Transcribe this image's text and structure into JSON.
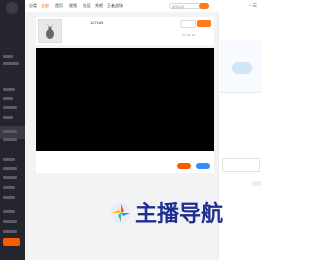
{
  "header": {
    "nav": [
      "分类",
      "全部",
      "首页",
      "视频",
      "社区",
      "秀吧",
      "王者战场"
    ],
    "active_nav_index": 1,
    "search": {
      "placeholder": "搜索房间"
    }
  },
  "room": {
    "anchor_name": "",
    "room_id": "127165",
    "sub_info": "",
    "follow_label": "",
    "orange_label": ""
  },
  "player": {
    "controls": [
      "",
      ""
    ]
  },
  "right_panel": {
    "title": "",
    "tabs": [
      "",
      ""
    ]
  },
  "watermark": {
    "text": "主播导航"
  },
  "colors": {
    "accent": "#ff5a00",
    "sidebar": "#24252d",
    "watermark": "#1e2f8f",
    "blue": "#2f8fff"
  }
}
